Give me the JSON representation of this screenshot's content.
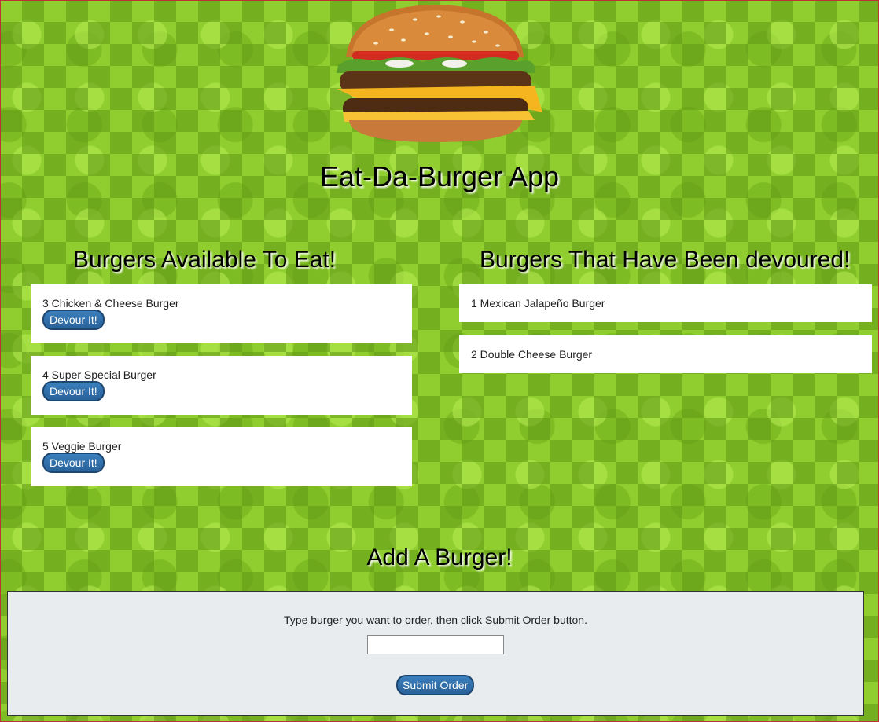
{
  "header": {
    "logo_icon": "burger-icon",
    "title": "Eat-Da-Burger App"
  },
  "available": {
    "title": "Burgers Available To Eat!",
    "items": [
      {
        "name": "3 Chicken & Cheese Burger",
        "button_label": "Devour It!"
      },
      {
        "name": "4 Super Special Burger",
        "button_label": "Devour It!"
      },
      {
        "name": "5 Veggie Burger",
        "button_label": "Devour It!"
      }
    ]
  },
  "devoured": {
    "title": "Burgers That Have Been devoured!",
    "items": [
      {
        "name": "1 Mexican Jalapeño Burger"
      },
      {
        "name": "2 Double Cheese Burger"
      }
    ]
  },
  "add_burger": {
    "title": "Add A Burger!",
    "instructions": "Type burger you want to order, then click Submit Order button.",
    "input_value": "",
    "input_placeholder": "",
    "submit_label": "Submit Order"
  },
  "colors": {
    "button_blue": "#2e6da4",
    "panel_bg": "#e8ecef",
    "background_green": "#8fce2e"
  }
}
